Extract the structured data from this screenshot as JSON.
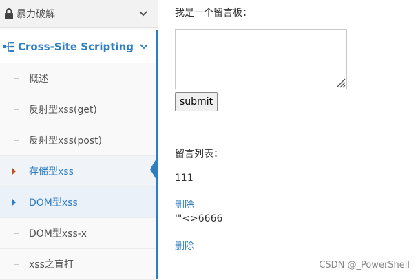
{
  "sidebar": {
    "top_item": {
      "label": "暴力破解",
      "icon": "lock-icon"
    },
    "active_section": {
      "label": "Cross-Site Scripting",
      "icon": "sitemap-icon"
    },
    "sub_items": [
      {
        "label": "概述"
      },
      {
        "label": "反射型xss(get)"
      },
      {
        "label": "反射型xss(post)"
      },
      {
        "label": "存储型xss",
        "state": "current"
      },
      {
        "label": "DOM型xss",
        "state": "hover"
      },
      {
        "label": "DOM型xss-x"
      },
      {
        "label": "xss之盲打"
      }
    ]
  },
  "main": {
    "board_label": "我是一个留言板：",
    "textarea_value": "",
    "submit_label": "submit",
    "list_label": "留言列表：",
    "messages": [
      {
        "text": "111",
        "delete_label": "删除"
      },
      {
        "text": "'\"<>6666",
        "delete_label": "删除"
      }
    ]
  },
  "watermark": "CSDN @_PowerShell",
  "colors": {
    "accent": "#2f7ec2",
    "current_marker": "#c0501f"
  }
}
